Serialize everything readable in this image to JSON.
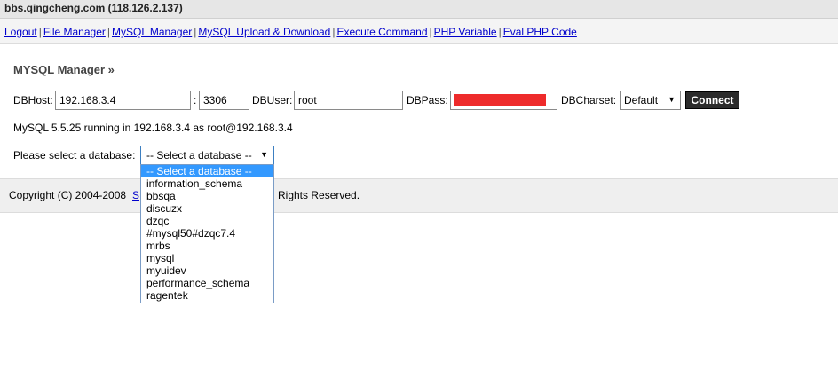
{
  "window": {
    "title": "bbs.qingcheng.com (118.126.2.137)"
  },
  "nav": {
    "items": [
      {
        "label": "Logout"
      },
      {
        "label": "File Manager"
      },
      {
        "label": "MySQL Manager"
      },
      {
        "label": "MySQL Upload & Download"
      },
      {
        "label": "Execute Command"
      },
      {
        "label": "PHP Variable"
      },
      {
        "label": "Eval PHP Code"
      }
    ],
    "separator": "|"
  },
  "page": {
    "title": "MYSQL Manager »"
  },
  "form": {
    "dbhost_label": "DBHost:",
    "dbhost_value": "192.168.3.4",
    "port_sep": ":",
    "port_value": "3306",
    "dbuser_label": "DBUser:",
    "dbuser_value": "root",
    "dbpass_label": "DBPass:",
    "dbcharset_label": "DBCharset:",
    "dbcharset_value": "Default",
    "connect_label": "Connect"
  },
  "status": "MySQL 5.5.25 running in 192.168.3.4 as root@192.168.3.4",
  "database": {
    "label": "Please select a database:",
    "selected": "-- Select a database --",
    "options": [
      "-- Select a database --",
      "information_schema",
      "bbsqa",
      "discuzx",
      "dzqc",
      "#mysql50#dzqc7.4",
      "mrbs",
      "mysql",
      "myuidev",
      "performance_schema",
      "ragentek"
    ]
  },
  "footer": {
    "left": "Copyright (C) 2004-2008",
    "link": "S",
    "right": "Rights Reserved."
  },
  "colors": {
    "link": "#0000cc",
    "redaction": "#ee2b2b",
    "dropdown_highlight": "#3399ff",
    "button_bg": "#2b2b2b"
  }
}
